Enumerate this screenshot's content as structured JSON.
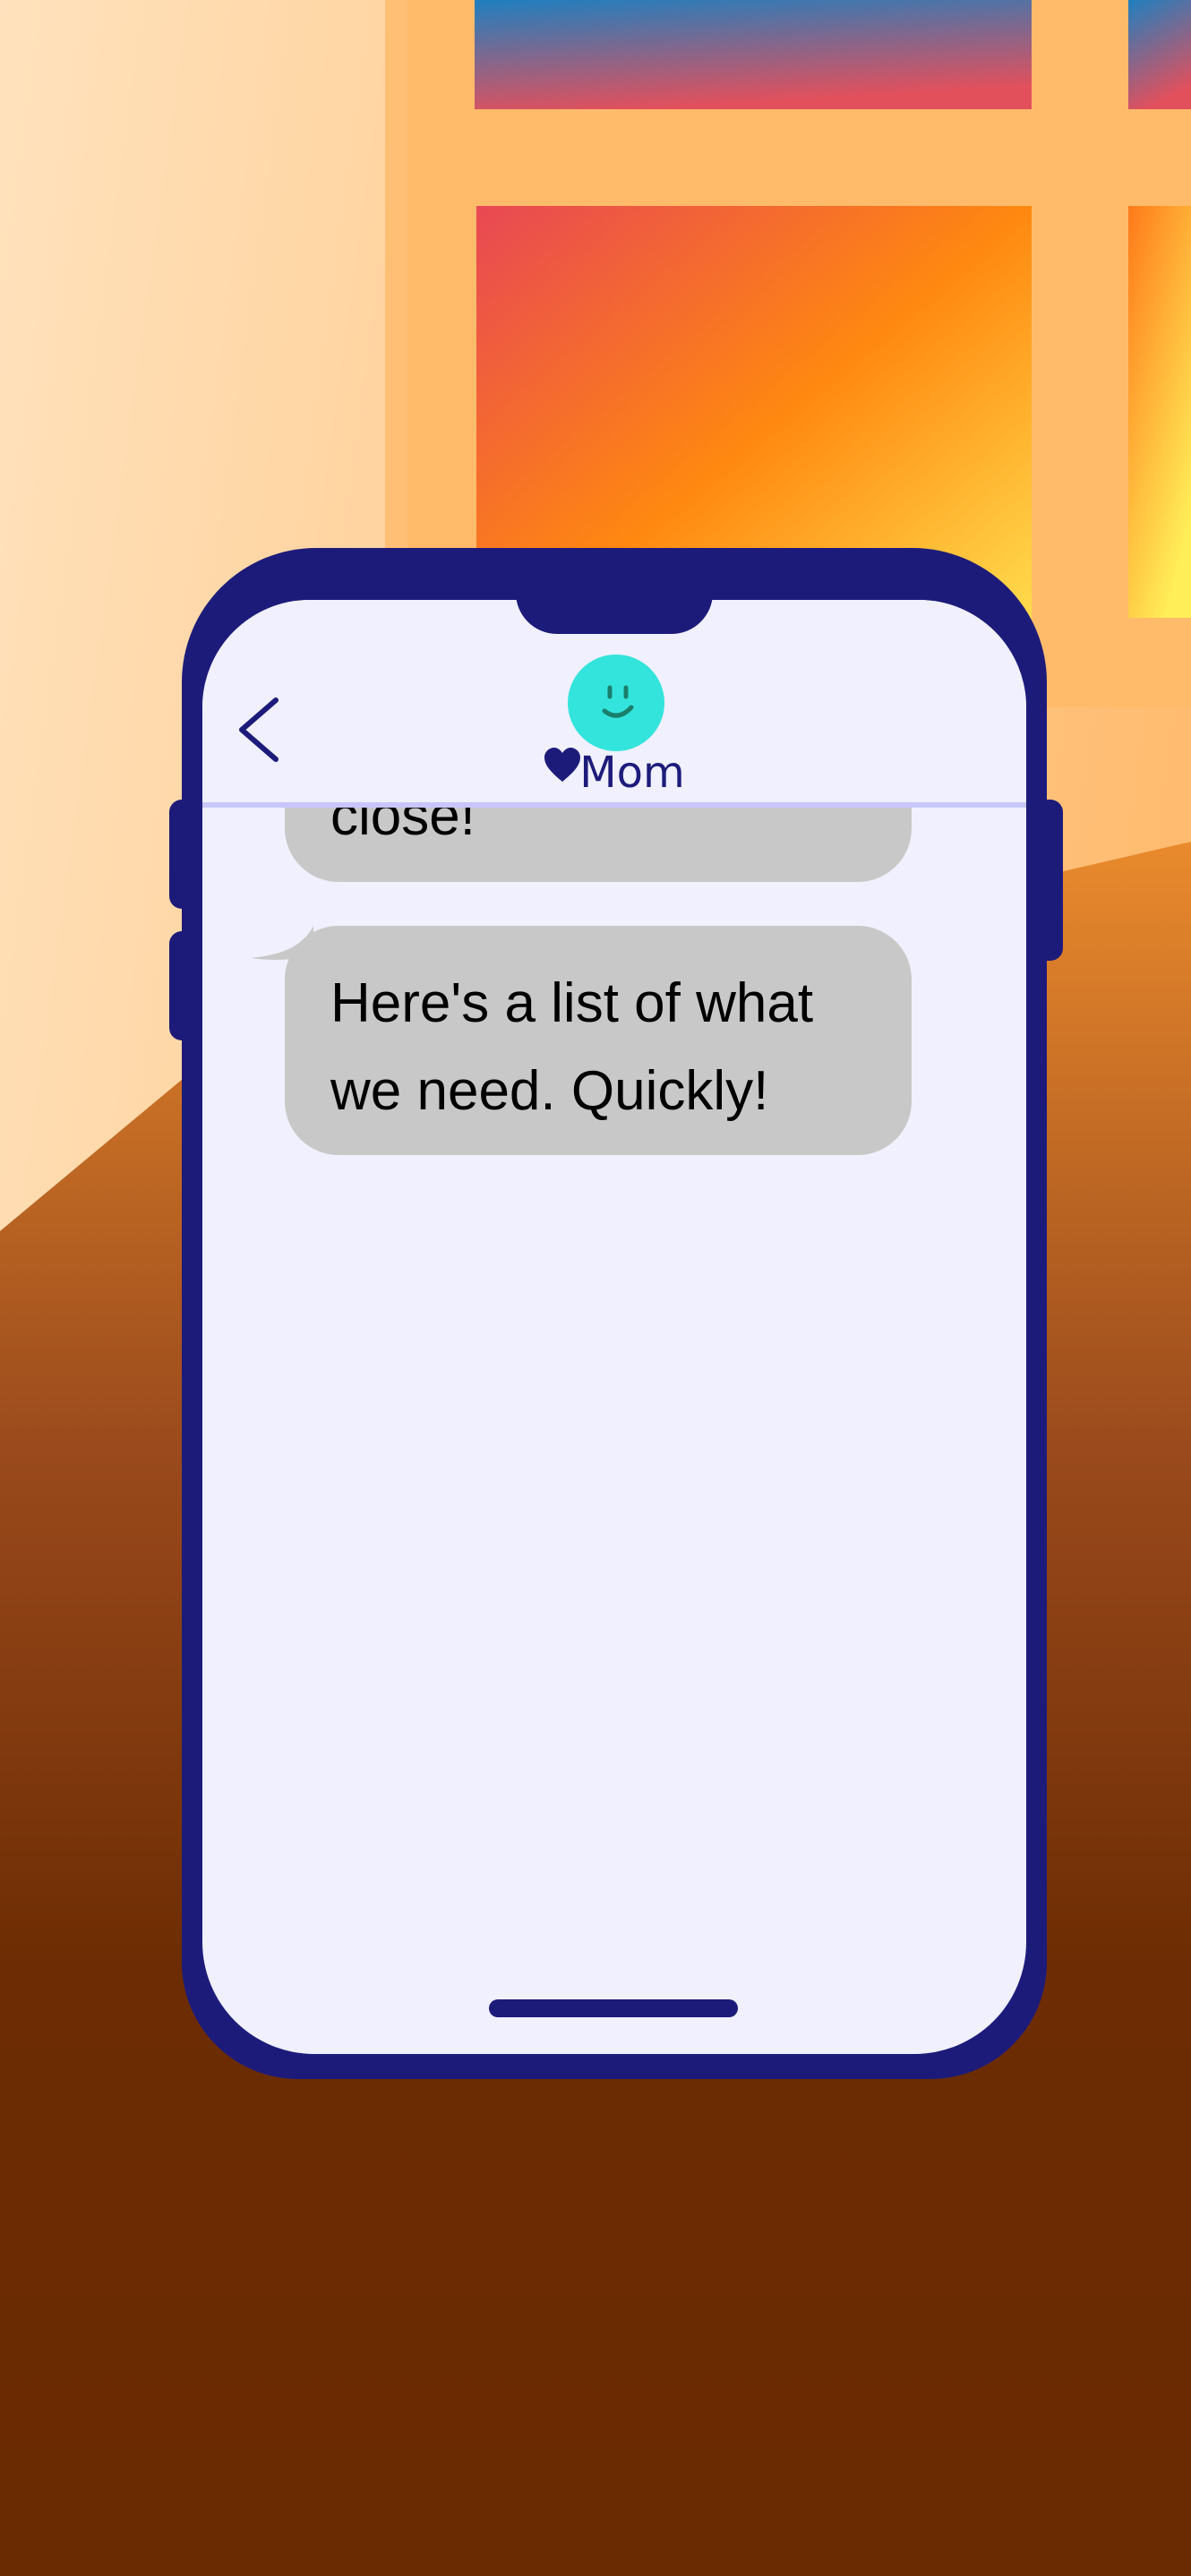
{
  "contact": {
    "name": "Mom",
    "avatar_icon": "smiley-face-icon",
    "name_badge_icon": "heart-icon"
  },
  "header": {
    "back_icon": "chevron-left-icon"
  },
  "messages": [
    {
      "from": "Mom",
      "text": "store is about to close!"
    },
    {
      "from": "Mom",
      "text": "Here's a list of what we need. Quickly!"
    }
  ],
  "colors": {
    "phone_body": "#1d1b7a",
    "screen": "#f0f0fe",
    "bubble": "#c8c8c8",
    "avatar": "#33e4dc",
    "header_divider": "#c8c6fb"
  }
}
